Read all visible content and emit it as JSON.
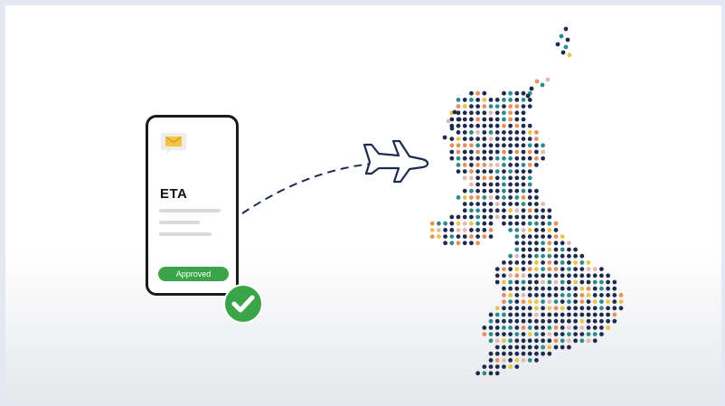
{
  "phone": {
    "title": "ETA",
    "status_label": "Approved",
    "message_icon": "envelope-message-icon"
  },
  "badge": {
    "icon": "checkmark-circle-icon"
  },
  "plane": {
    "icon": "airplane-icon"
  },
  "map": {
    "icon": "uk-dot-map",
    "colors": {
      "navy": "#1d2c4d",
      "teal": "#2c8c8c",
      "yellow": "#e8c449",
      "orange": "#e88f5b",
      "pink": "#e5b8b0"
    }
  },
  "colors": {
    "approved_green": "#3aa548",
    "envelope_yellow": "#f4c542",
    "path_navy": "#1d2c4d"
  }
}
